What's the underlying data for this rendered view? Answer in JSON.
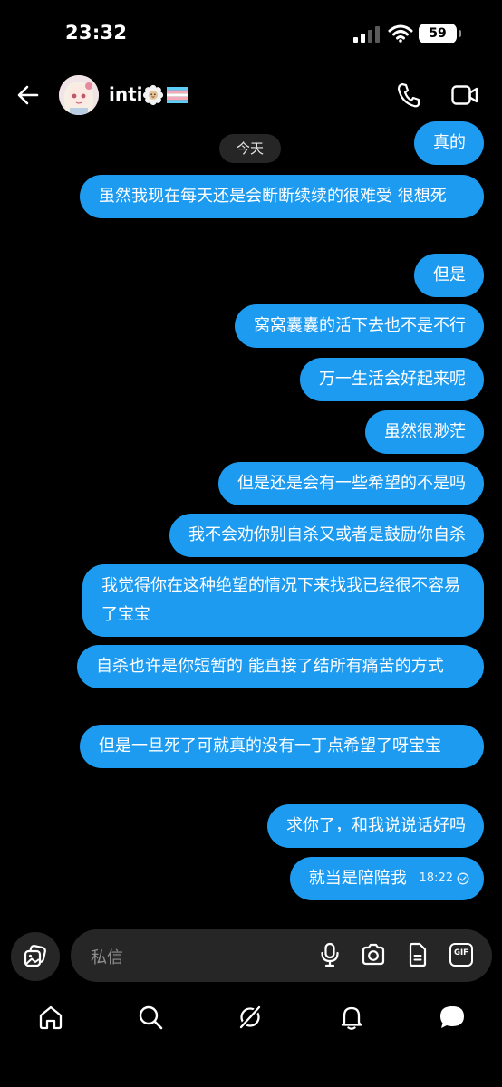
{
  "status_bar": {
    "time": "23:32",
    "battery": "59"
  },
  "header": {
    "contact_name": "inti",
    "icons": [
      "back-arrow-icon",
      "avatar",
      "flower-emoji",
      "trans-flag-emoji",
      "phone-icon",
      "video-icon"
    ]
  },
  "date_divider": "今天",
  "messages": [
    {
      "text": "真的"
    },
    {
      "text": "虽然我现在每天还是会断断续续的很难受 很想死"
    },
    {
      "text": "但是"
    },
    {
      "text": "窝窝囊囊的活下去也不是不行"
    },
    {
      "text": "万一生活会好起来呢"
    },
    {
      "text": "虽然很渺茫"
    },
    {
      "text": "但是还是会有一些希望的不是吗"
    },
    {
      "text": "我不会劝你别自杀又或者是鼓励你自杀"
    },
    {
      "text": "我觉得你在这种绝望的情况下来找我已经很不容易了宝宝"
    },
    {
      "text": "自杀也许是你短暂的 能直接了结所有痛苦的方式"
    },
    {
      "text": "但是一旦死了可就真的没有一丁点希望了呀宝宝"
    },
    {
      "text": "求你了，和我说说话好吗"
    },
    {
      "text": "就当是陪陪我",
      "time": "18:22"
    }
  ],
  "composer": {
    "placeholder": "私信",
    "gif_label": "GIF"
  },
  "colors": {
    "bubble": "#1d9bf0",
    "background": "#000000",
    "input": "#262626"
  }
}
